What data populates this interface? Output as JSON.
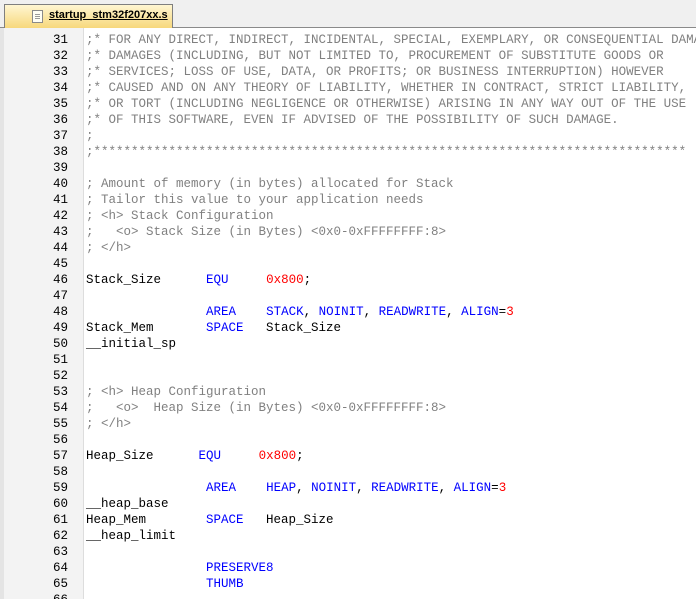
{
  "tab": {
    "title": "startup_stm32f207xx.s"
  },
  "colors": {
    "comment": "#808080",
    "keyword": "#0000ff",
    "number": "#ff0000",
    "text": "#000000"
  },
  "editor": {
    "lines": [
      {
        "n": "31",
        "segs": [
          {
            "t": ";* FOR ANY DIRECT, INDIRECT, INCIDENTAL, SPECIAL, EXEMPLARY, OR CONSEQUENTIAL DAMAGES",
            "c": "c"
          }
        ]
      },
      {
        "n": "32",
        "segs": [
          {
            "t": ";* DAMAGES (INCLUDING, BUT NOT LIMITED TO, PROCUREMENT OF SUBSTITUTE GOODS OR",
            "c": "c"
          }
        ]
      },
      {
        "n": "33",
        "segs": [
          {
            "t": ";* SERVICES; LOSS OF USE, DATA, OR PROFITS; OR BUSINESS INTERRUPTION) HOWEVER",
            "c": "c"
          }
        ]
      },
      {
        "n": "34",
        "segs": [
          {
            "t": ";* CAUSED AND ON ANY THEORY OF LIABILITY, WHETHER IN CONTRACT, STRICT LIABILITY,",
            "c": "c"
          }
        ]
      },
      {
        "n": "35",
        "segs": [
          {
            "t": ";* OR TORT (INCLUDING NEGLIGENCE OR OTHERWISE) ARISING IN ANY WAY OUT OF THE USE",
            "c": "c"
          }
        ]
      },
      {
        "n": "36",
        "segs": [
          {
            "t": ";* OF THIS SOFTWARE, EVEN IF ADVISED OF THE POSSIBILITY OF SUCH DAMAGE.",
            "c": "c"
          }
        ]
      },
      {
        "n": "37",
        "segs": [
          {
            "t": ";",
            "c": "c"
          }
        ]
      },
      {
        "n": "38",
        "segs": [
          {
            "t": ";*******************************************************************************",
            "c": "c"
          }
        ]
      },
      {
        "n": "39",
        "segs": []
      },
      {
        "n": "40",
        "segs": [
          {
            "t": "; Amount of memory (in bytes) allocated for Stack",
            "c": "c"
          }
        ]
      },
      {
        "n": "41",
        "segs": [
          {
            "t": "; Tailor this value to your application needs",
            "c": "c"
          }
        ]
      },
      {
        "n": "42",
        "segs": [
          {
            "t": "; <h> Stack Configuration",
            "c": "c"
          }
        ]
      },
      {
        "n": "43",
        "segs": [
          {
            "t": ";   <o> Stack Size (in Bytes) <0x0-0xFFFFFFFF:8>",
            "c": "c"
          }
        ]
      },
      {
        "n": "44",
        "segs": [
          {
            "t": "; </h>",
            "c": "c"
          }
        ]
      },
      {
        "n": "45",
        "segs": []
      },
      {
        "n": "46",
        "segs": [
          {
            "t": "Stack_Size      "
          },
          {
            "t": "EQU",
            "c": "k"
          },
          {
            "t": "     "
          },
          {
            "t": "0x800",
            "c": "n"
          },
          {
            "t": ";"
          }
        ]
      },
      {
        "n": "47",
        "segs": []
      },
      {
        "n": "48",
        "segs": [
          {
            "t": "                "
          },
          {
            "t": "AREA",
            "c": "k"
          },
          {
            "t": "    "
          },
          {
            "t": "STACK",
            "c": "k"
          },
          {
            "t": ", "
          },
          {
            "t": "NOINIT",
            "c": "k"
          },
          {
            "t": ", "
          },
          {
            "t": "READWRITE",
            "c": "k"
          },
          {
            "t": ", "
          },
          {
            "t": "ALIGN",
            "c": "k"
          },
          {
            "t": "="
          },
          {
            "t": "3",
            "c": "n"
          }
        ]
      },
      {
        "n": "49",
        "segs": [
          {
            "t": "Stack_Mem       "
          },
          {
            "t": "SPACE",
            "c": "k"
          },
          {
            "t": "   Stack_Size"
          }
        ]
      },
      {
        "n": "50",
        "segs": [
          {
            "t": "__initial_sp"
          }
        ]
      },
      {
        "n": "51",
        "segs": []
      },
      {
        "n": "52",
        "segs": []
      },
      {
        "n": "53",
        "segs": [
          {
            "t": "; <h> Heap Configuration",
            "c": "c"
          }
        ]
      },
      {
        "n": "54",
        "segs": [
          {
            "t": ";   <o>  Heap Size (in Bytes) <0x0-0xFFFFFFFF:8>",
            "c": "c"
          }
        ]
      },
      {
        "n": "55",
        "segs": [
          {
            "t": "; </h>",
            "c": "c"
          }
        ]
      },
      {
        "n": "56",
        "segs": []
      },
      {
        "n": "57",
        "segs": [
          {
            "t": "Heap_Size      "
          },
          {
            "t": "EQU",
            "c": "k"
          },
          {
            "t": "     "
          },
          {
            "t": "0x800",
            "c": "n"
          },
          {
            "t": ";"
          }
        ]
      },
      {
        "n": "58",
        "segs": []
      },
      {
        "n": "59",
        "segs": [
          {
            "t": "                "
          },
          {
            "t": "AREA",
            "c": "k"
          },
          {
            "t": "    "
          },
          {
            "t": "HEAP",
            "c": "k"
          },
          {
            "t": ", "
          },
          {
            "t": "NOINIT",
            "c": "k"
          },
          {
            "t": ", "
          },
          {
            "t": "READWRITE",
            "c": "k"
          },
          {
            "t": ", "
          },
          {
            "t": "ALIGN",
            "c": "k"
          },
          {
            "t": "="
          },
          {
            "t": "3",
            "c": "n"
          }
        ]
      },
      {
        "n": "60",
        "segs": [
          {
            "t": "__heap_base"
          }
        ]
      },
      {
        "n": "61",
        "segs": [
          {
            "t": "Heap_Mem        "
          },
          {
            "t": "SPACE",
            "c": "k"
          },
          {
            "t": "   Heap_Size"
          }
        ]
      },
      {
        "n": "62",
        "segs": [
          {
            "t": "__heap_limit"
          }
        ]
      },
      {
        "n": "63",
        "segs": []
      },
      {
        "n": "64",
        "segs": [
          {
            "t": "                "
          },
          {
            "t": "PRESERVE8",
            "c": "k"
          }
        ]
      },
      {
        "n": "65",
        "segs": [
          {
            "t": "                "
          },
          {
            "t": "THUMB",
            "c": "k"
          }
        ]
      },
      {
        "n": "66",
        "segs": []
      }
    ]
  }
}
